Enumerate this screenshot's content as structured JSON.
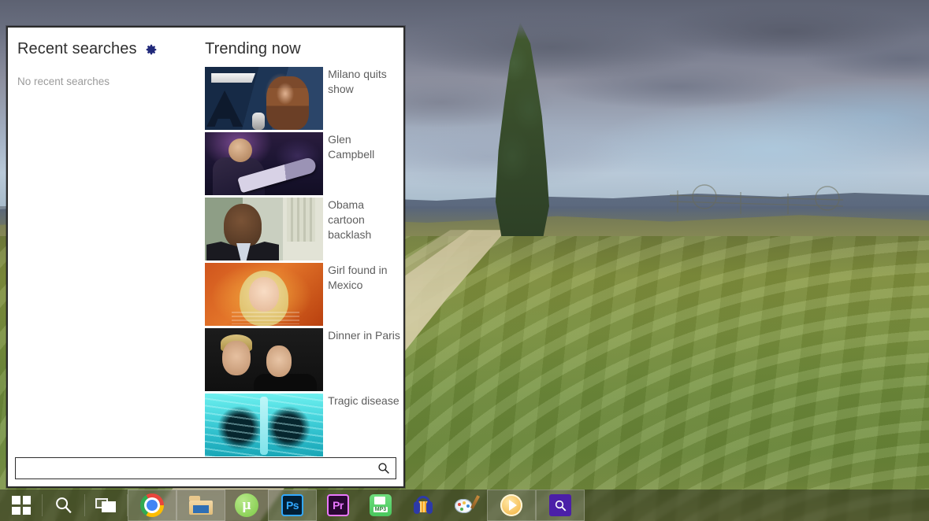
{
  "panel": {
    "recent": {
      "title": "Recent searches",
      "settings_icon": "gear-icon",
      "empty_message": "No recent searches"
    },
    "trending": {
      "title": "Trending now",
      "items": [
        {
          "label": "Milano quits show",
          "thumb": "milano-thumbnail"
        },
        {
          "label": "Glen Campbell",
          "thumb": "glen-campbell-thumbnail"
        },
        {
          "label": "Obama cartoon backlash",
          "thumb": "obama-thumbnail"
        },
        {
          "label": "Girl found in Mexico",
          "thumb": "girl-found-thumbnail"
        },
        {
          "label": "Dinner in Paris",
          "thumb": "dinner-in-paris-thumbnail"
        },
        {
          "label": "Tragic disease",
          "thumb": "xray-thumbnail"
        }
      ]
    },
    "search": {
      "value": "",
      "placeholder": "",
      "button_icon": "search-icon"
    }
  },
  "taskbar": {
    "items": [
      {
        "name": "start-button",
        "icon": "windows-logo-icon",
        "label": "Start",
        "pinned": false
      },
      {
        "name": "search-button",
        "icon": "search-icon",
        "label": "Search",
        "pinned": false
      },
      {
        "name": "task-view-button",
        "icon": "task-view-icon",
        "label": "Task View",
        "pinned": false
      },
      {
        "name": "taskbar-item-chrome",
        "icon": "chrome-icon",
        "label": "Google Chrome",
        "pinned": true
      },
      {
        "name": "taskbar-item-explorer",
        "icon": "file-explorer-icon",
        "label": "File Explorer",
        "pinned": true
      },
      {
        "name": "taskbar-item-utorrent",
        "icon": "utorrent-icon",
        "label": "uTorrent",
        "pinned": false
      },
      {
        "name": "taskbar-item-photoshop",
        "icon": "photoshop-icon",
        "label": "Ps",
        "pinned": true
      },
      {
        "name": "taskbar-item-premiere",
        "icon": "premiere-icon",
        "label": "Pr",
        "pinned": false
      },
      {
        "name": "taskbar-item-mp3",
        "icon": "mp3-converter-icon",
        "label": "MP3",
        "pinned": false
      },
      {
        "name": "taskbar-item-audacity",
        "icon": "audacity-icon",
        "label": "Audacity",
        "pinned": false
      },
      {
        "name": "taskbar-item-paint",
        "icon": "paint-icon",
        "label": "Paint",
        "pinned": false
      },
      {
        "name": "taskbar-item-player",
        "icon": "media-player-icon",
        "label": "Media Player",
        "pinned": true
      },
      {
        "name": "taskbar-item-everything",
        "icon": "everything-search-icon",
        "label": "Everything",
        "pinned": true
      }
    ]
  },
  "colors": {
    "panel_background": "#ffffff",
    "panel_border": "#2b2b2b",
    "heading_text": "#2f2f2f",
    "item_text": "#5e5e5e",
    "muted_text": "#9b9b9b",
    "gear_accent": "#21297a",
    "taskbar_background": "rgba(40,42,28,.55)"
  },
  "desktop": {
    "wallpaper_description": "countryside landscape with poplar tree, dirt track and cloudy sky"
  }
}
